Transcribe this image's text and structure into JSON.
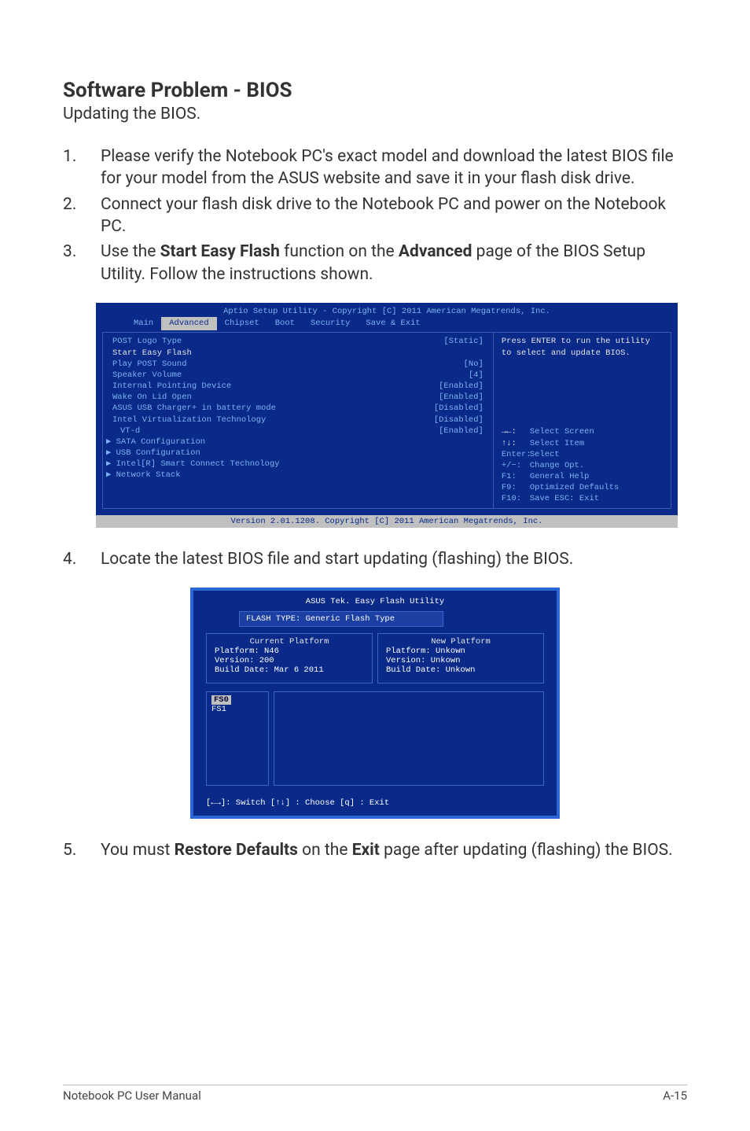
{
  "title": "Software Problem - BIOS",
  "subtitle": "Updating the BIOS.",
  "steps": {
    "s1": "Please verify the Notebook PC's exact model and download the latest BIOS file for your model from the ASUS website and save it in your flash disk drive.",
    "s2": "Connect your flash disk drive to the Notebook PC and power on the Notebook PC.",
    "s3a": "Use the ",
    "s3b": "Start Easy Flash",
    "s3c": " function on the ",
    "s3d": "Advanced",
    "s3e": " page of the BIOS Setup Utility. Follow the instructions shown.",
    "s4": "Locate the latest BIOS file and start updating (flashing) the BIOS.",
    "s5a": "You must ",
    "s5b": "Restore Defaults",
    "s5c": " on the ",
    "s5d": "Exit",
    "s5e": " page after updating (flashing) the BIOS."
  },
  "bios": {
    "header": "Aptio Setup Utility - Copyright [C] 2011 American Megatrends, Inc.",
    "tabs": [
      "Main",
      "Advanced",
      "Chipset",
      "Boot",
      "Security",
      "Save & Exit"
    ],
    "rows": [
      {
        "l": "POST Logo Type",
        "v": "[Static]"
      },
      {
        "l": "Start Easy Flash",
        "v": "",
        "hi": true
      },
      {
        "l": "Play POST Sound",
        "v": "[No]"
      },
      {
        "l": "Speaker Volume",
        "v": "[4]"
      },
      {
        "l": "Internal Pointing Device",
        "v": "[Enabled]"
      },
      {
        "l": "Wake On Lid Open",
        "v": "[Enabled]"
      },
      {
        "l": "ASUS USB Charger+ in battery mode",
        "v": "[Disabled]"
      },
      {
        "l": "",
        "v": ""
      },
      {
        "l": "Intel Virtualization Technology",
        "v": "[Disabled]"
      },
      {
        "l": "VT-d",
        "v": "[Enabled]"
      }
    ],
    "submenus": [
      "SATA Configuration",
      "USB Configuration",
      "Intel[R] Smart Connect Technology",
      "Network Stack"
    ],
    "help": "Press ENTER to run the utility to select and update BIOS.",
    "keys": [
      {
        "k": "→←:",
        "d": "Select Screen"
      },
      {
        "k": "↑↓:",
        "d": "Select Item"
      },
      {
        "k": "Enter:",
        "d": "Select"
      },
      {
        "k": "+/−:",
        "d": "Change Opt."
      },
      {
        "k": "F1:",
        "d": "General Help"
      },
      {
        "k": "F9:",
        "d": "Optimized Defaults"
      },
      {
        "k": "F10:",
        "d": "Save   ESC: Exit"
      }
    ],
    "footer": "Version 2.01.1208. Copyright [C] 2011 American Megatrends, Inc."
  },
  "easy": {
    "title": "ASUS Tek. Easy Flash Utility",
    "flashtype": "FLASH TYPE: Generic Flash Type",
    "current": {
      "title": "Current Platform",
      "platform": "Platform:  N46",
      "version": "Version:    200",
      "build": "Build Date: Mar 6 2011"
    },
    "new": {
      "title": "New Platform",
      "platform": "Platform:  Unkown",
      "version": "Version:    Unkown",
      "build": "Build Date: Unkown"
    },
    "fs0": "FS0",
    "fs1": "FS1",
    "keys": "[←→]: Switch   [↑↓] : Choose   [q] : Exit"
  },
  "footer": {
    "left": "Notebook PC User Manual",
    "right": "A-15"
  }
}
